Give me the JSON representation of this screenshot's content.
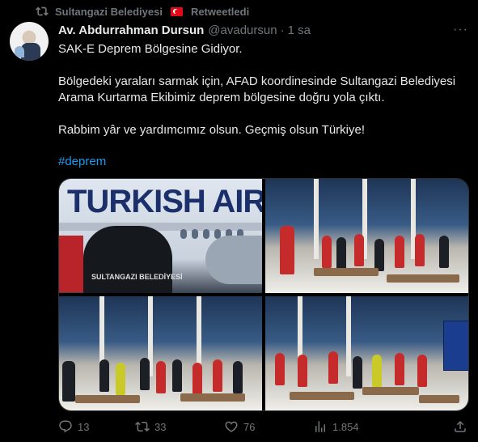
{
  "retweet": {
    "account": "Sultangazi Belediyesi",
    "action": "Retweetledi"
  },
  "tweet": {
    "display_name": "Av. Abdurrahman Dursun",
    "handle": "@avadursun",
    "separator": "·",
    "time": "1 sa",
    "more": "···",
    "paragraphs": [
      "SAK-E Deprem Bölgesine Gidiyor.",
      "Bölgedeki yaraları sarmak için, AFAD koordinesinde Sultangazi Belediyesi Arama Kurtarma Ekibimiz deprem bölgesine doğru yola çıktı.",
      "Rabbim yâr ve yardımcımız olsun. Geçmiş olsun Türkiye!"
    ],
    "hashtag": "#deprem"
  },
  "media": {
    "aircraft_text": "TURKISH AIRL",
    "badge_text": "SULTANGAZI BELEDİYESİ"
  },
  "actions": {
    "replies": "13",
    "retweets": "33",
    "likes": "76",
    "views": "1.854"
  },
  "icons": {
    "retweet": "retweet-icon",
    "reply": "reply-icon",
    "like": "heart-icon",
    "views": "analytics-icon",
    "share": "share-icon"
  },
  "colors": {
    "accent": "#1d9bf0",
    "muted": "#71767b",
    "background": "#000000"
  }
}
